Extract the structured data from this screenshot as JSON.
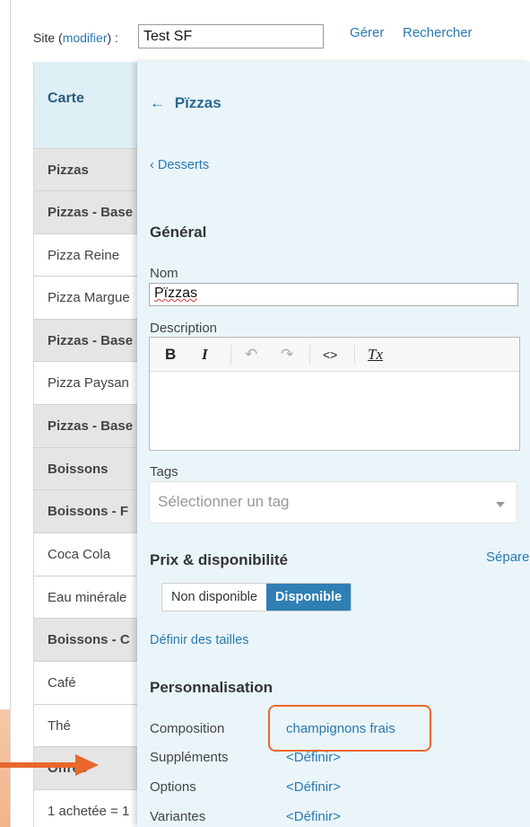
{
  "site": {
    "label_prefix": "Site",
    "label_modify": "modifier",
    "label_suffix": ":",
    "value": "Test SF",
    "links": [
      "Gérer",
      "Rechercher"
    ]
  },
  "menu": {
    "header": "Carte",
    "rows": [
      {
        "label": "Pizzas",
        "kind": "cat"
      },
      {
        "label": "Pizzas - Base",
        "kind": "cat"
      },
      {
        "label": "Pizza Reine",
        "kind": "item"
      },
      {
        "label": "Pizza Margue",
        "kind": "item"
      },
      {
        "label": "Pizzas - Base",
        "kind": "cat"
      },
      {
        "label": "Pizza Paysan",
        "kind": "item"
      },
      {
        "label": "Pizzas - Base",
        "kind": "cat"
      },
      {
        "label": "Boissons",
        "kind": "cat"
      },
      {
        "label": "Boissons - F",
        "kind": "cat"
      },
      {
        "label": "Coca Cola",
        "kind": "item"
      },
      {
        "label": "Eau minérale",
        "kind": "item"
      },
      {
        "label": "Boissons - C",
        "kind": "cat"
      },
      {
        "label": "Café",
        "kind": "item"
      },
      {
        "label": "Thé",
        "kind": "item"
      },
      {
        "label": "Offres",
        "kind": "cat"
      },
      {
        "label": "1 achetée = 1",
        "kind": "item"
      }
    ]
  },
  "panel": {
    "title": "Pïzzas",
    "back_link": "Desserts",
    "general": {
      "heading": "Général",
      "name_label": "Nom",
      "name_value": "Pïzzas",
      "description_label": "Description",
      "toolbar": [
        "B",
        "I",
        "↶",
        "↷",
        "<>",
        "Tx"
      ],
      "tags_label": "Tags",
      "tags_placeholder": "Sélectionner un tag"
    },
    "pricing": {
      "heading": "Prix & disponibilité",
      "side_link": "Sépare",
      "toggle_off": "Non disponible",
      "toggle_on": "Disponible",
      "sizes_link": "Définir des tailles"
    },
    "customization": {
      "heading": "Personnalisation",
      "rows": [
        {
          "label": "Composition",
          "value": "champignons frais"
        },
        {
          "label": "Suppléments",
          "value": "<Définir>"
        },
        {
          "label": "Options",
          "value": "<Définir>"
        },
        {
          "label": "Variantes",
          "value": "<Définir>"
        }
      ]
    }
  },
  "colors": {
    "accent": "#2f7fb5",
    "link": "#2a7ab0",
    "panel_bg": "#eaf5f9",
    "highlight": "#e8682c"
  }
}
